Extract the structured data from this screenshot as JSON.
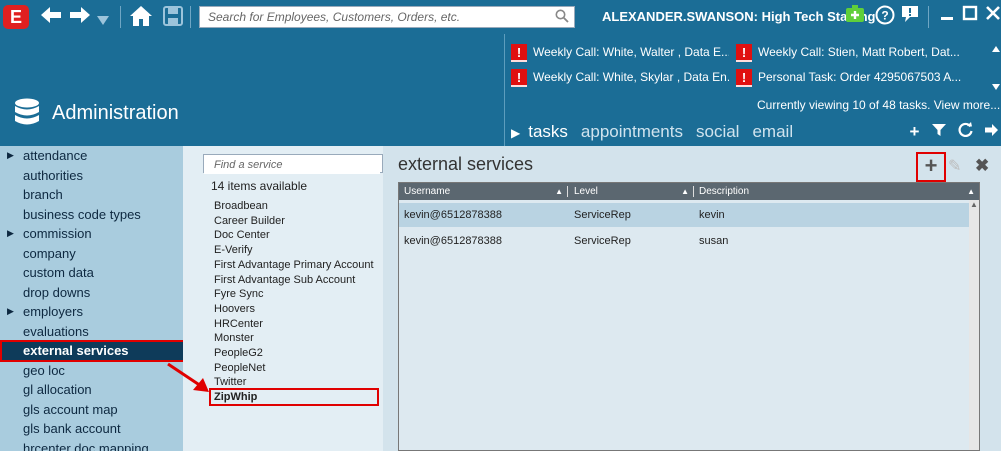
{
  "app": {
    "logo_letter": "E",
    "user": "ALEXANDER.SWANSON: High Tech Staffing",
    "icons": [
      "back-arrow-icon",
      "forward-arrow-icon",
      "history-dropdown-icon",
      "home-icon",
      "save-icon",
      "search-icon",
      "new-record-icon",
      "help-icon",
      "notifications-icon",
      "minimize-icon",
      "maximize-icon",
      "close-icon"
    ]
  },
  "search": {
    "placeholder": "Search for Employees, Customers, Orders, etc."
  },
  "header": {
    "title": "Administration"
  },
  "tasks": {
    "items": [
      {
        "text": "Weekly Call: White, Walter , Data E..."
      },
      {
        "text": "Weekly Call: Stien, Matt Robert, Dat..."
      },
      {
        "text": "Weekly Call: White, Skylar , Data En..."
      },
      {
        "text": "Personal Task: Order 4295067503 A..."
      }
    ],
    "viewing": "Currently viewing 10 of 48 tasks. View more...",
    "tabs": [
      "tasks",
      "appointments",
      "social",
      "email"
    ],
    "active_tab": "tasks"
  },
  "nav": {
    "items": [
      {
        "label": "attendance",
        "expandable": true
      },
      {
        "label": "authorities",
        "expandable": false
      },
      {
        "label": "branch",
        "expandable": false
      },
      {
        "label": "business code types",
        "expandable": false
      },
      {
        "label": "commission",
        "expandable": true
      },
      {
        "label": "company",
        "expandable": false
      },
      {
        "label": "custom data",
        "expandable": false
      },
      {
        "label": "drop downs",
        "expandable": false
      },
      {
        "label": "employers",
        "expandable": true
      },
      {
        "label": "evaluations",
        "expandable": false
      },
      {
        "label": "external services",
        "expandable": false
      },
      {
        "label": "geo loc",
        "expandable": false
      },
      {
        "label": "gl allocation",
        "expandable": false
      },
      {
        "label": "gls account map",
        "expandable": false
      },
      {
        "label": "gls bank account",
        "expandable": false
      },
      {
        "label": "hrcenter doc mapping",
        "expandable": false
      }
    ],
    "selected": "external services"
  },
  "services": {
    "find_placeholder": "Find a service",
    "count": "14 items available",
    "items": [
      "Broadbean",
      "Career Builder",
      "Doc Center",
      "E-Verify",
      "First Advantage Primary Account",
      "First Advantage Sub Account",
      "Fyre Sync",
      "Hoovers",
      "HRCenter",
      "Monster",
      "PeopleG2",
      "PeopleNet",
      "Twitter",
      "ZipWhip"
    ],
    "highlighted": "ZipWhip"
  },
  "main": {
    "title": "external services",
    "columns": [
      "Username",
      "Level",
      "Description"
    ],
    "rows": [
      {
        "username": "kevin@6512878388",
        "level": "ServiceRep",
        "description": "kevin"
      },
      {
        "username": "kevin@6512878388",
        "level": "ServiceRep",
        "description": "susan"
      }
    ],
    "actions": {
      "add": "+",
      "edit": "✎",
      "delete": "✖"
    }
  },
  "colors": {
    "header_blue": "#1b6d96",
    "selected_nav": "#0e3b5a",
    "highlight_red": "#e00000",
    "alert_red": "#e01010"
  }
}
